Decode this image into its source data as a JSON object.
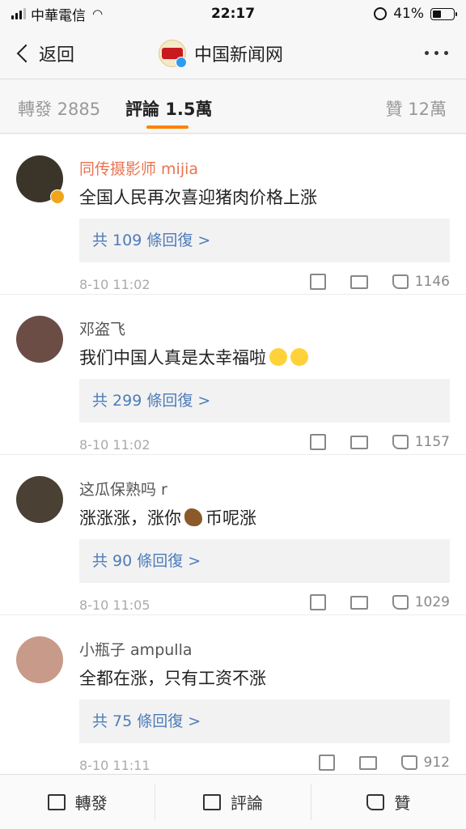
{
  "status_bar": {
    "carrier": "中華電信",
    "time": "22:17",
    "battery": "41%",
    "battery_level": 0.41
  },
  "nav": {
    "back_label": "返回",
    "title": "中国新闻网"
  },
  "tabs": {
    "repost": "轉發 2885",
    "comments": "評論 1.5萬",
    "likes": "贊 12萬"
  },
  "comments": [
    {
      "username": "同传摄影师 mijia",
      "text": "全国人民再次喜迎猪肉价格上涨",
      "replies": "共 109 條回復 >",
      "time": "8-10 11:02",
      "likes": "1146"
    },
    {
      "username": "邓盗飞",
      "text": "我们中国人真是太幸福啦",
      "replies": "共 299 條回復 >",
      "time": "8-10 11:02",
      "likes": "1157"
    },
    {
      "username": "这瓜保熟吗 r",
      "text_a": "涨涨涨，涨你",
      "text_b": "币呢涨",
      "replies": "共 90 條回復 >",
      "time": "8-10 11:05",
      "likes": "1029"
    },
    {
      "username": "小瓶子 ampulla",
      "text": "全都在涨，只有工资不涨",
      "replies": "共 75 條回復 >",
      "time": "8-10 11:11",
      "likes": "912"
    }
  ],
  "toolbar": {
    "repost": "轉發",
    "comment": "評論",
    "like": "贊"
  },
  "colors": {
    "accent": "#ff8200",
    "link": "#4d7cb8",
    "vip_name": "#eb7350"
  }
}
